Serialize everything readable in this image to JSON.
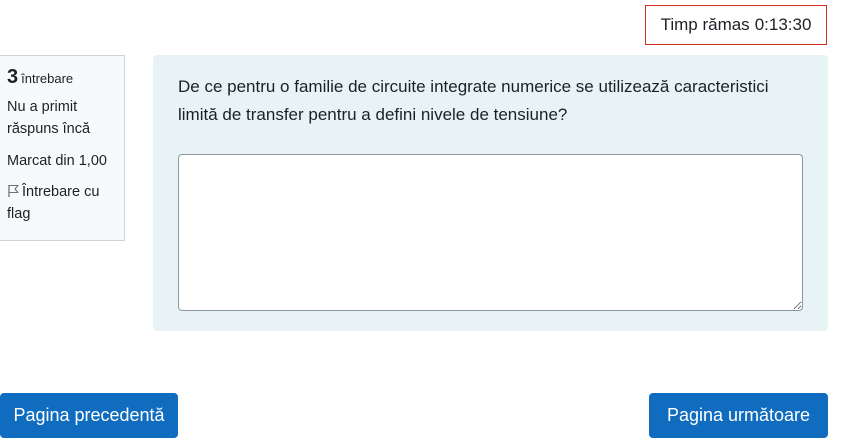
{
  "timer": {
    "label": "Timp rămas",
    "value": "0:13:30"
  },
  "question_info": {
    "number": "3",
    "number_label": "întrebare",
    "state": "Nu a primit răspuns încă",
    "grade": "Marcat din 1,00",
    "flag_label": "Întrebare cu flag",
    "flag_icon": "flag-outline-icon"
  },
  "question": {
    "text": "De ce pentru o familie de circuite integrate numerice se utilizează caracteristici limită de transfer pentru a defini nivele de tensiune?",
    "answer_value": ""
  },
  "navigation": {
    "prev_label": "Pagina precedentă",
    "next_label": "Pagina următoare"
  },
  "colors": {
    "primary_button": "#0f6cbf",
    "timer_border": "#ca3120",
    "question_background": "#e7f3f5",
    "info_background": "#f8f9fa"
  }
}
